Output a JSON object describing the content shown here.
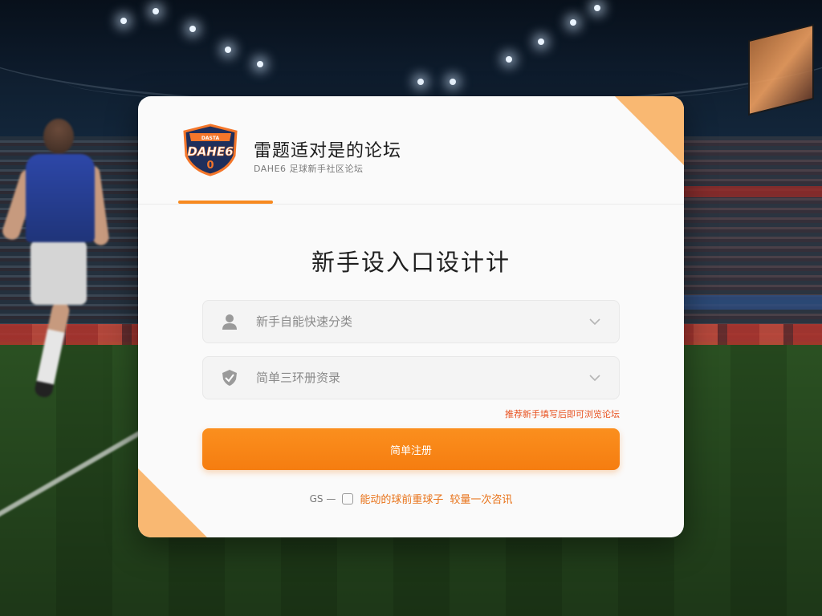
{
  "brand": {
    "logo_text": "DAHE6",
    "logo_small": "DASTA",
    "title": "雷题适对是的论坛",
    "subtitle": "DAHE6 足球新手社区论坛"
  },
  "main": {
    "page_title": "新手设入口设计计",
    "field1": {
      "placeholder": "新手自能快速分类",
      "icon": "user-icon"
    },
    "field2": {
      "placeholder": "简单三环册资录",
      "icon": "shield-check-icon"
    },
    "hint": "推荐新手填写后即可浏览论坛",
    "submit_label": "简单注册"
  },
  "footer": {
    "prefix": "GS —",
    "text": "能动的球前重球子",
    "link": "较量一次咨讯"
  },
  "colors": {
    "accent": "#f7891f",
    "corner": "#f9b872",
    "hint": "#e8511f"
  }
}
